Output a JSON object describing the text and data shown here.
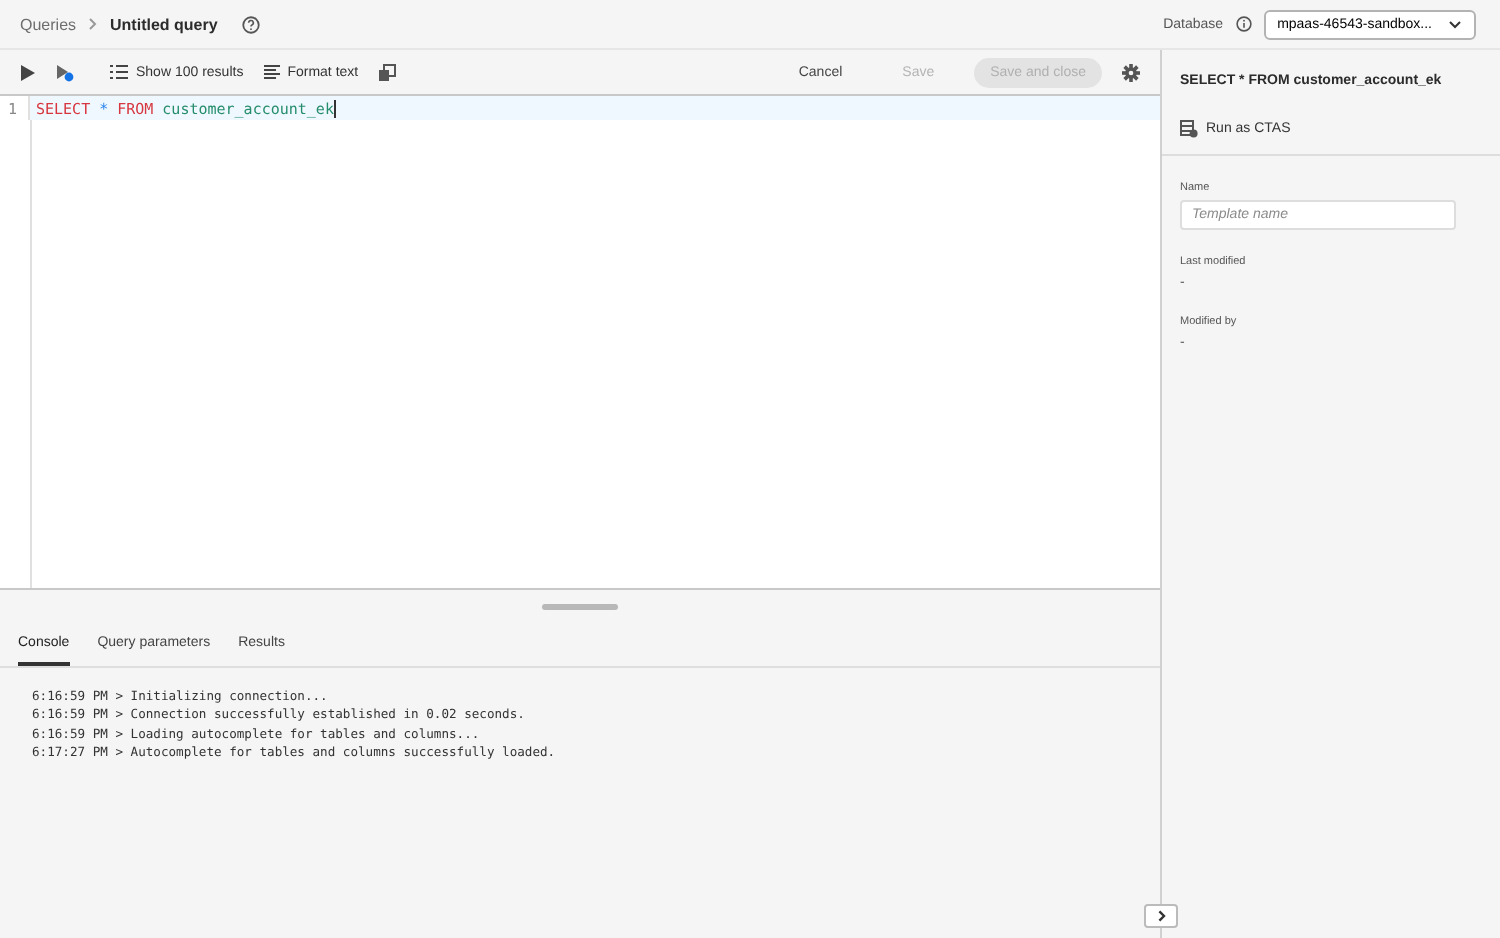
{
  "breadcrumb": {
    "parent": "Queries",
    "current": "Untitled query"
  },
  "database": {
    "label": "Database",
    "value": "mpaas-46543-sandbox..."
  },
  "toolbar": {
    "show_results": "Show 100 results",
    "format_text": "Format text",
    "cancel": "Cancel",
    "save": {
      "label": "Save",
      "disabled": true
    },
    "save_and_close": {
      "label": "Save and close",
      "disabled": true
    }
  },
  "editor": {
    "lines": [
      {
        "number": "1",
        "tokens": [
          {
            "text": "SELECT",
            "kind": "keyword"
          },
          {
            "text": "*",
            "kind": "operator"
          },
          {
            "text": "FROM",
            "kind": "keyword"
          },
          {
            "text": "customer_account_ek",
            "kind": "identifier"
          }
        ]
      }
    ]
  },
  "tabs": [
    {
      "label": "Console",
      "selected": true
    },
    {
      "label": "Query parameters",
      "selected": false
    },
    {
      "label": "Results",
      "selected": false
    }
  ],
  "console": [
    "6:16:59 PM > Initializing connection...",
    "6:16:59 PM > Connection successfully established in 0.02 seconds.",
    "6:16:59 PM > Loading autocomplete for tables and columns...",
    "6:17:27 PM > Autocomplete for tables and columns successfully loaded."
  ],
  "side_panel": {
    "title": "SELECT * FROM customer_account_ek",
    "run_as_ctas": "Run as CTAS",
    "fields": [
      {
        "label": "Name",
        "kind": "input",
        "placeholder": "Template name"
      },
      {
        "label": "Last modified",
        "kind": "text",
        "value": "-"
      },
      {
        "label": "Modified by",
        "kind": "text",
        "value": "-"
      }
    ]
  }
}
